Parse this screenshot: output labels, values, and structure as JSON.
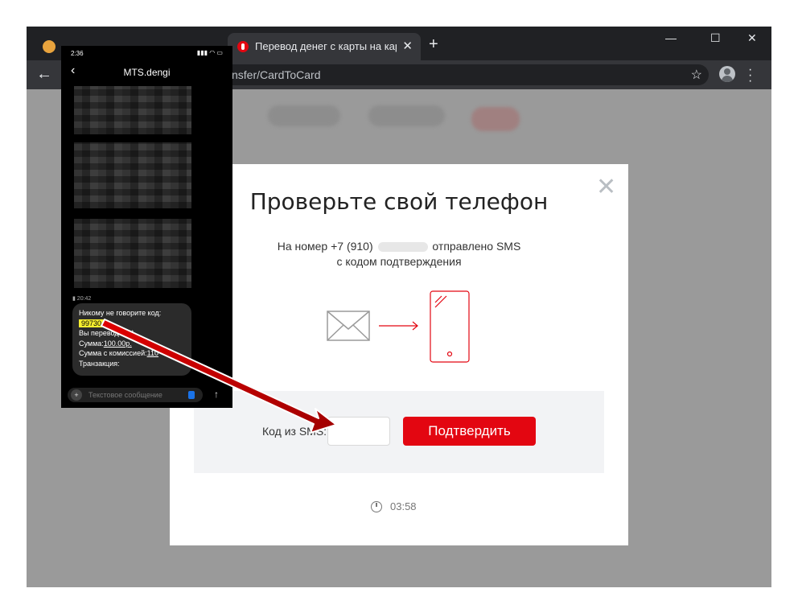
{
  "browser": {
    "tabs": [
      {
        "label": "Перевод денег с карты на карту",
        "active": true,
        "close": "✕"
      }
    ],
    "new_tab": "+",
    "window_controls": {
      "minimize": "—",
      "maximize": "☐",
      "close": "✕"
    },
    "url": "nsfer/CardToCard"
  },
  "phone": {
    "time": "2:36",
    "chat_title": "MTS.dengi",
    "message_time": "20:42",
    "message_lines": {
      "l1": "Никому не говорите код:",
      "code": "99730",
      "l3": "Вы перевод",
      "l3b": "на *",
      "l4a": "Сумма:",
      "l4b": "100.00р.",
      "l5a": "Сумма с комиссией:",
      "l5b": "110",
      "l6": "Транзакция:"
    },
    "input_placeholder": "Текстовое сообщение"
  },
  "modal": {
    "title": "Проверьте свой телефон",
    "sms_prefix": "На номер +7 (910)",
    "sms_suffix": "отправлено SMS",
    "sms_line2": "с кодом подтверждения",
    "code_label": "Код из SMS:",
    "code_value": "",
    "confirm_button": "Подтвердить",
    "timer": "03:58",
    "accent_color": "#e30611"
  }
}
